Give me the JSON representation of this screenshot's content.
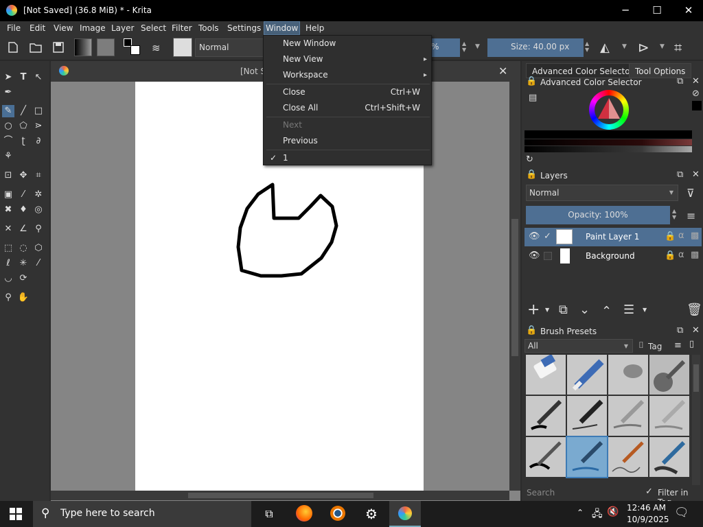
{
  "window": {
    "title": "[Not Saved]  (36.8 MiB) * - Krita",
    "minimize": "─",
    "maximize": "☐",
    "close": "✕"
  },
  "menubar": {
    "items": [
      "File",
      "Edit",
      "View",
      "Image",
      "Layer",
      "Select",
      "Filter",
      "Tools",
      "Settings",
      "Window",
      "Help"
    ],
    "selected": "Window"
  },
  "toolbar": {
    "blend_mode": "Normal",
    "opacity_value": "%",
    "size_label": "Size: 40.00 px"
  },
  "document_tab": {
    "title": "[Not S"
  },
  "window_menu": {
    "items": [
      {
        "label": "New Window",
        "shortcut": "",
        "disabled": false
      },
      {
        "label": "New View",
        "shortcut": "",
        "disabled": false,
        "submenu": true
      },
      {
        "label": "Workspace",
        "shortcut": "",
        "disabled": false,
        "submenu": true
      },
      {
        "label": "Close",
        "shortcut": "Ctrl+W",
        "disabled": false
      },
      {
        "label": "Close All",
        "shortcut": "Ctrl+Shift+W",
        "disabled": false
      },
      {
        "label": "Next",
        "shortcut": "",
        "disabled": true
      },
      {
        "label": "Previous",
        "shortcut": "",
        "disabled": false
      },
      {
        "label": "1",
        "shortcut": "",
        "disabled": false,
        "checked": true
      }
    ]
  },
  "right_panel": {
    "tabs": [
      "Advanced Color Selector",
      "Tool Options"
    ],
    "color_selector_title": "Advanced Color Selector",
    "layers_title": "Layers",
    "layers_blend": "Normal",
    "layers_opacity": "Opacity:  100%",
    "layers": [
      {
        "name": "Paint Layer 1",
        "visible": true,
        "selected": true
      },
      {
        "name": "Background",
        "visible": true,
        "selected": false
      }
    ],
    "brush_presets_title": "Brush Presets",
    "brush_filter": "All",
    "brush_tag": "Tag",
    "search_placeholder": "Search",
    "filter_in_tag": "Filter in Tag"
  },
  "taskbar": {
    "search_placeholder": "Type here to search",
    "time": "12:46 AM",
    "date": "10/9/2025"
  }
}
